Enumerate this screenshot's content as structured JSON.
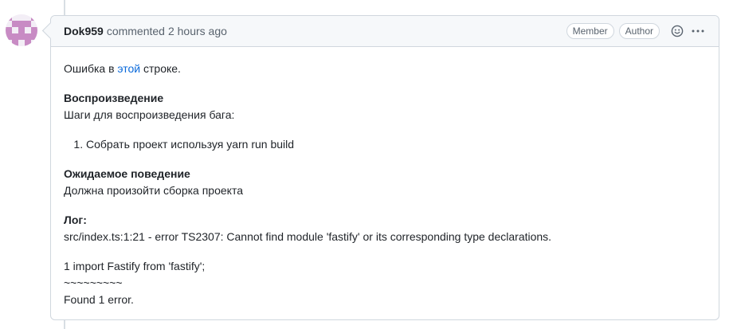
{
  "comment": {
    "author": "Dok959",
    "action": "commented",
    "time": "2 hours ago",
    "badges": [
      "Member",
      "Author"
    ],
    "icons": {
      "reaction": "smiley-icon",
      "menu": "kebab-icon"
    }
  },
  "body": {
    "intro_prefix": "Ошибка в",
    "intro_link": "этой",
    "intro_suffix": "строке.",
    "repro_heading": "Воспроизведение",
    "repro_text": "Шаги для воспроизведения бага:",
    "steps": [
      "Собрать проект используя yarn run build"
    ],
    "expected_heading": "Ожидаемое поведение",
    "expected_text": "Должна произойти сборка проекта",
    "log_heading": "Лог:",
    "log_error": "src/index.ts:1:21 - error TS2307: Cannot find module 'fastify' or its corresponding type declarations.",
    "log_line1": "1 import Fastify from 'fastify';",
    "log_line2": "~~~~~~~~~",
    "log_line3": "Found 1 error."
  }
}
